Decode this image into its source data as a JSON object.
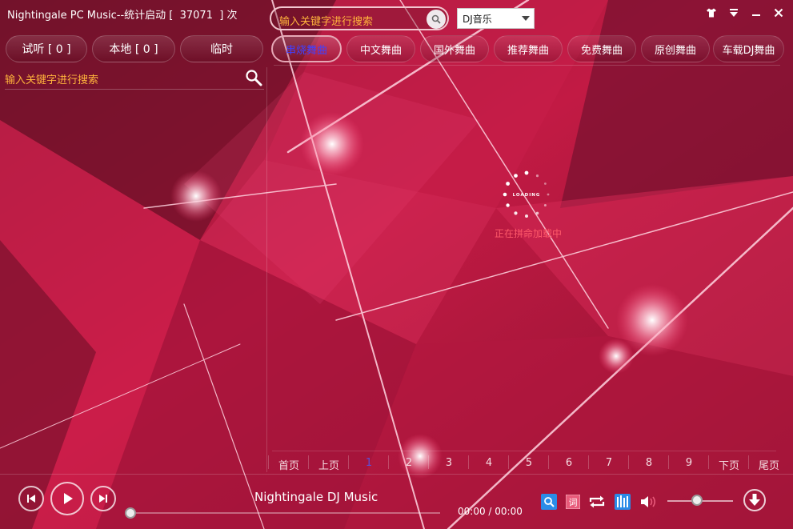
{
  "window": {
    "title": "Nightingale PC Music--统计启动 [  37071  ] 次",
    "search_placeholder": "输入关键字进行搜索",
    "source_selected": "DJ音乐",
    "controls": [
      "skin-icon",
      "menu-icon",
      "minimize-icon",
      "close-icon"
    ]
  },
  "left_tabs": [
    {
      "label": "试听 [ 0 ]"
    },
    {
      "label": "本地 [ 0 ]"
    },
    {
      "label": "临时"
    }
  ],
  "left_search": {
    "placeholder": "输入关键字进行搜索"
  },
  "categories": [
    {
      "label": "串烧舞曲",
      "active": true
    },
    {
      "label": "中文舞曲",
      "active": false
    },
    {
      "label": "国外舞曲",
      "active": false
    },
    {
      "label": "推荐舞曲",
      "active": false
    },
    {
      "label": "免费舞曲",
      "active": false
    },
    {
      "label": "原创舞曲",
      "active": false
    },
    {
      "label": "车载DJ舞曲",
      "active": false
    }
  ],
  "loading": {
    "spinner_text": "LOADING",
    "message": "正在拼命加载中"
  },
  "pager": {
    "first": "首页",
    "prev": "上页",
    "pages": [
      "1",
      "2",
      "3",
      "4",
      "5",
      "6",
      "7",
      "8",
      "9"
    ],
    "current": "1",
    "next": "下页",
    "last": "尾页"
  },
  "player": {
    "track_title": "Nightingale DJ Music",
    "time_current": "00:00",
    "time_total": "00:00",
    "progress": 0,
    "volume": 0.45,
    "tools": [
      "search-icon",
      "lyrics-icon",
      "repeat-icon",
      "equalizer-icon",
      "volume-icon"
    ],
    "lyrics_glyph": "词"
  },
  "colors": {
    "accent_orange": "#ffb43c",
    "active_tab_text": "#4040ff",
    "loading_text": "#ff5a6a",
    "background_red": "#b0163a"
  }
}
